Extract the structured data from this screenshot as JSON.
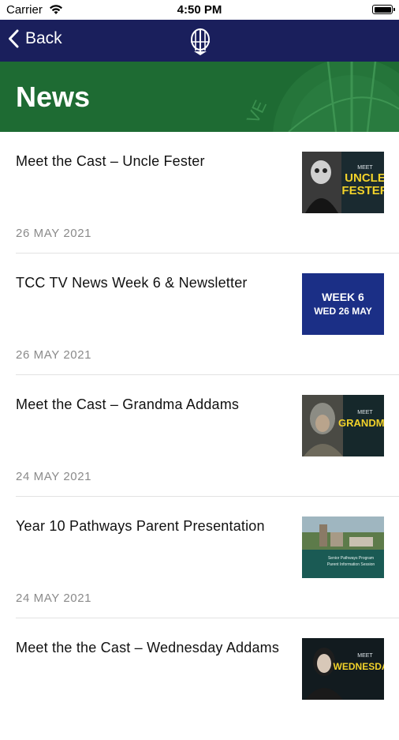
{
  "status_bar": {
    "carrier": "Carrier",
    "time": "4:50 PM"
  },
  "nav": {
    "back_label": "Back",
    "logo_icon": "school-crest-icon"
  },
  "header": {
    "title": "News",
    "bg_color": "#1e6b33"
  },
  "news_items": [
    {
      "title": "Meet the Cast – Uncle Fester",
      "date": "26 MAY 2021",
      "thumb": {
        "line1": "MEET",
        "line2": "UNCLE",
        "line3": "FESTER"
      }
    },
    {
      "title": "TCC TV News Week 6 & Newsletter",
      "date": "26 MAY 2021",
      "thumb": {
        "line1": "WEEK 6",
        "line2": "WED 26 MAY"
      }
    },
    {
      "title": "Meet the Cast – Grandma Addams",
      "date": "24 MAY 2021",
      "thumb": {
        "line1": "MEET",
        "line2": "GRANDMA"
      }
    },
    {
      "title": "Year 10 Pathways Parent Presentation",
      "date": "24 MAY 2021",
      "thumb": {
        "line1": "Senior Pathways Program",
        "line2": "Parent Information Session"
      }
    },
    {
      "title": "Meet the the Cast – Wednesday Addams",
      "date": "",
      "thumb": {
        "line1": "MEET",
        "line2": "WEDNESDAY"
      }
    }
  ]
}
